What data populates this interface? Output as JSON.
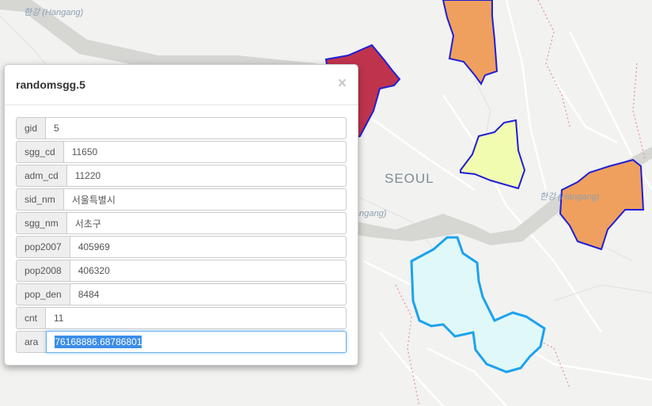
{
  "map": {
    "city_label": "SEOUL",
    "river_label_1": "한강 (Hangang)",
    "river_label_2": "한강 (Hangang)",
    "river_label_3": "angang)",
    "colors": {
      "crimson": "#c0334d",
      "orange": "#f0a05e",
      "yellow": "#f2fcb0",
      "cyan": "#e0f8f8",
      "outline": "#1f1fd6",
      "selected_outline": "#1ca2ee"
    }
  },
  "modal": {
    "title": "randomsgg.5",
    "close_glyph": "×",
    "fields": [
      {
        "label": "gid",
        "value": "5"
      },
      {
        "label": "sgg_cd",
        "value": "11650"
      },
      {
        "label": "adm_cd",
        "value": "11220"
      },
      {
        "label": "sid_nm",
        "value": "서울특별시"
      },
      {
        "label": "sgg_nm",
        "value": "서초구"
      },
      {
        "label": "pop2007",
        "value": "405969"
      },
      {
        "label": "pop2008",
        "value": "406320"
      },
      {
        "label": "pop_den",
        "value": "8484"
      },
      {
        "label": "cnt",
        "value": "11"
      },
      {
        "label": "ara",
        "value": "76168886.68786801"
      }
    ]
  }
}
